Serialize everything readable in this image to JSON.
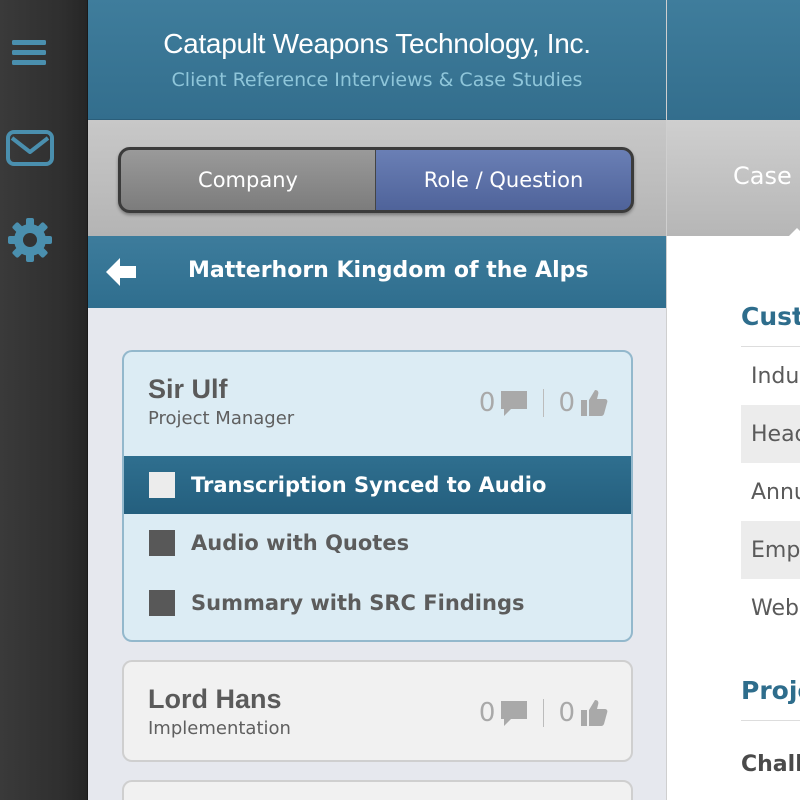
{
  "app": {
    "title": "Catapult Weapons Technology, Inc.",
    "subtitle": "Client Reference Interviews & Case Studies"
  },
  "rail": {
    "icons": [
      "menu-icon",
      "mail-icon",
      "gear-icon"
    ],
    "color": "#4a8fae"
  },
  "segmented": {
    "options": [
      "Company",
      "Role / Question"
    ],
    "selected": "Role / Question"
  },
  "breadcrumb": {
    "title": "Matterhorn Kingdom of the Alps",
    "back_icon": "back-arrow-icon"
  },
  "interviews": [
    {
      "name": "Sir Ulf",
      "role": "Project Manager",
      "comments": "0",
      "likes": "0",
      "expanded": true,
      "items": [
        {
          "label": "Transcription Synced to Audio",
          "active": true
        },
        {
          "label": "Audio with Quotes",
          "active": false
        },
        {
          "label": "Summary with SRC Findings",
          "active": false
        }
      ]
    },
    {
      "name": "Lord Hans",
      "role": "Implementation",
      "comments": "0",
      "likes": "0",
      "expanded": false
    }
  ],
  "right_panel": {
    "tab": "Case",
    "section1": "Cust",
    "rows": [
      "Indus",
      "Head",
      "Annu",
      "Emp",
      "Web"
    ],
    "section2": "Proje",
    "label": "Chall"
  },
  "colors": {
    "header": "#3a7798",
    "accent_blue": "#2e6d8c",
    "segment_on": "#5a6ea6"
  }
}
